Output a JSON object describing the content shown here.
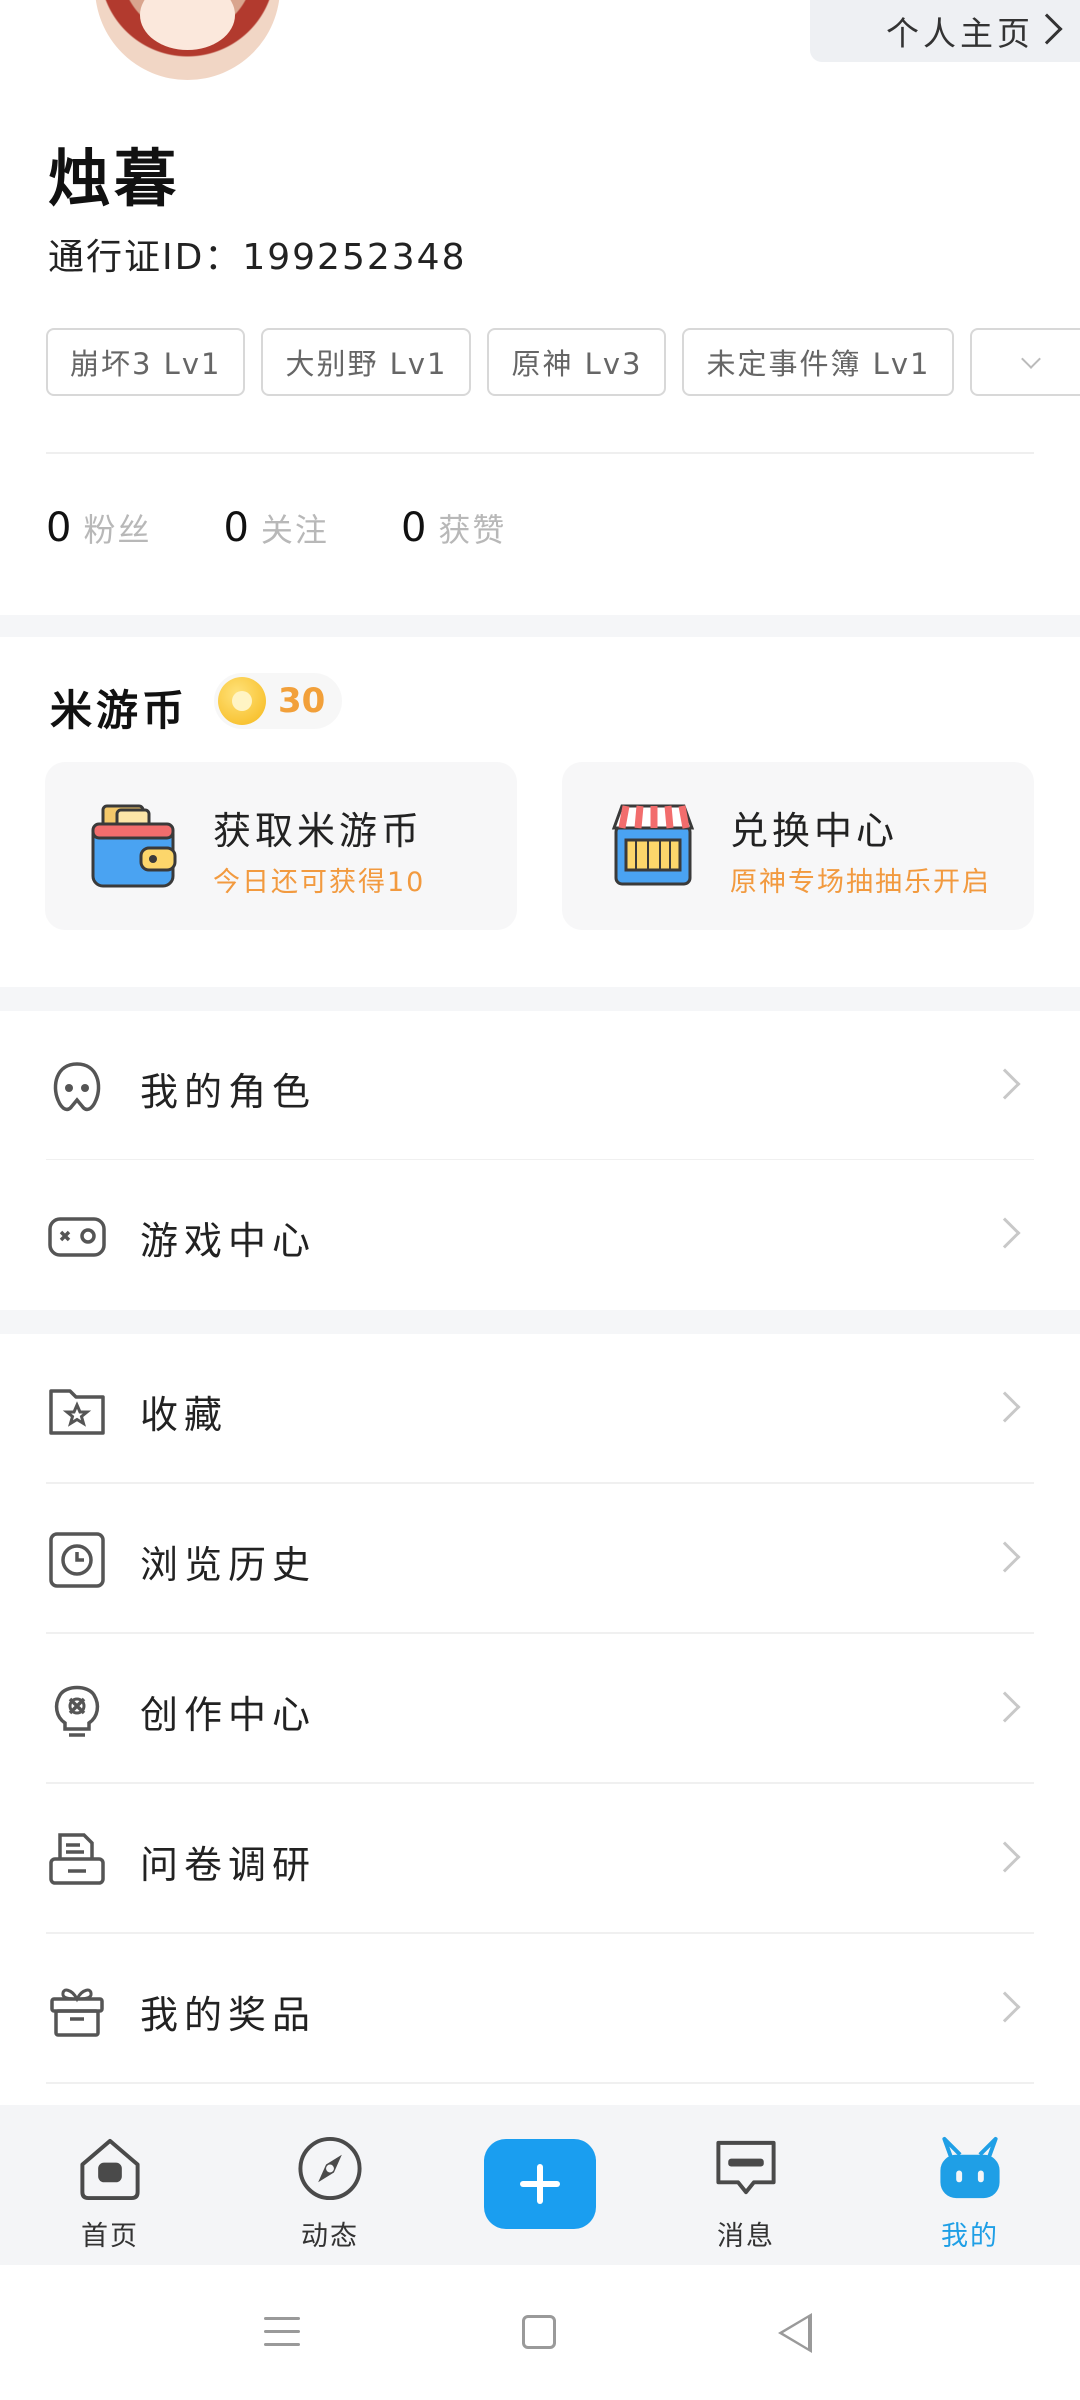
{
  "profile": {
    "homepage_label": "个人主页",
    "username": "烛暮",
    "passport_id": "通行证ID：199252348",
    "tags": [
      "崩坏3 Lv1",
      "大别野 Lv1",
      "原神 Lv3",
      "未定事件簿 Lv1"
    ],
    "stats": [
      {
        "num": "0",
        "label": "粉丝"
      },
      {
        "num": "0",
        "label": "关注"
      },
      {
        "num": "0",
        "label": "获赞"
      }
    ]
  },
  "coins": {
    "title": "米游币",
    "count": "30",
    "cards": [
      {
        "title": "获取米游币",
        "subtitle": "今日还可获得10",
        "icon": "wallet-icon"
      },
      {
        "title": "兑换中心",
        "subtitle": "原神专场抽抽乐开启",
        "icon": "shop-icon"
      }
    ]
  },
  "menu": {
    "group1": [
      {
        "label": "我的角色",
        "icon": "character-icon"
      },
      {
        "label": "游戏中心",
        "icon": "gamepad-icon"
      }
    ],
    "group2": [
      {
        "label": "收藏",
        "icon": "star-folder-icon"
      },
      {
        "label": "浏览历史",
        "icon": "clock-icon"
      },
      {
        "label": "创作中心",
        "icon": "lightbulb-icon"
      },
      {
        "label": "问卷调研",
        "icon": "survey-icon"
      },
      {
        "label": "我的奖品",
        "icon": "gift-icon"
      }
    ]
  },
  "bottom_nav": {
    "items": [
      {
        "label": "首页",
        "icon": "home-icon"
      },
      {
        "label": "动态",
        "icon": "compass-icon"
      },
      {
        "label": "消息",
        "icon": "message-icon"
      },
      {
        "label": "我的",
        "icon": "mascot-icon"
      }
    ],
    "active_color": "#1f9fe6",
    "plus_color": "#1a9ef0"
  },
  "colors": {
    "accent_orange": "#f29a3f",
    "coin_orange": "#f2a03a"
  }
}
